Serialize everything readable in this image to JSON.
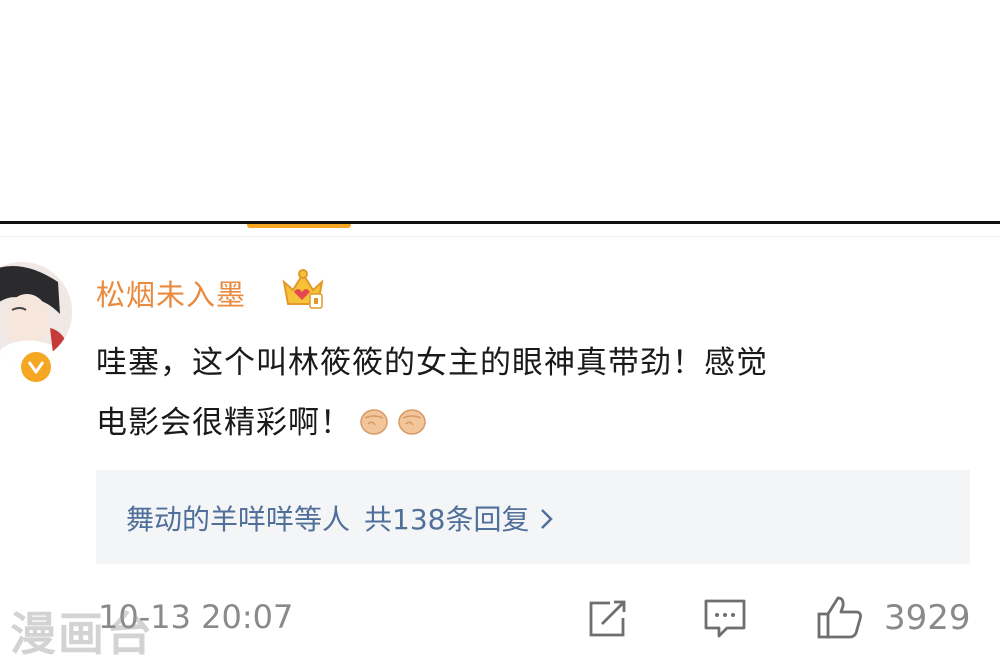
{
  "comment": {
    "username": "松烟未入墨",
    "text_line1": "哇塞，这个叫林筱筱的女主的眼神真带劲！感觉",
    "text_line2": "电影会很精彩啊！",
    "emoji": "fist-emoji",
    "replies": {
      "summary": "舞动的羊咩咩等人",
      "count": "共138条回复"
    },
    "timestamp": "10-13 20:07",
    "like_count": "3929"
  },
  "watermark": "漫画台",
  "colors": {
    "username": "#e98a3f",
    "link": "#50709a",
    "accent": "#f5a623",
    "meta": "#8a8a8a"
  },
  "icons": [
    "verified-icon",
    "crown-icon",
    "chevron-right-icon",
    "share-icon",
    "comment-icon",
    "like-icon"
  ]
}
